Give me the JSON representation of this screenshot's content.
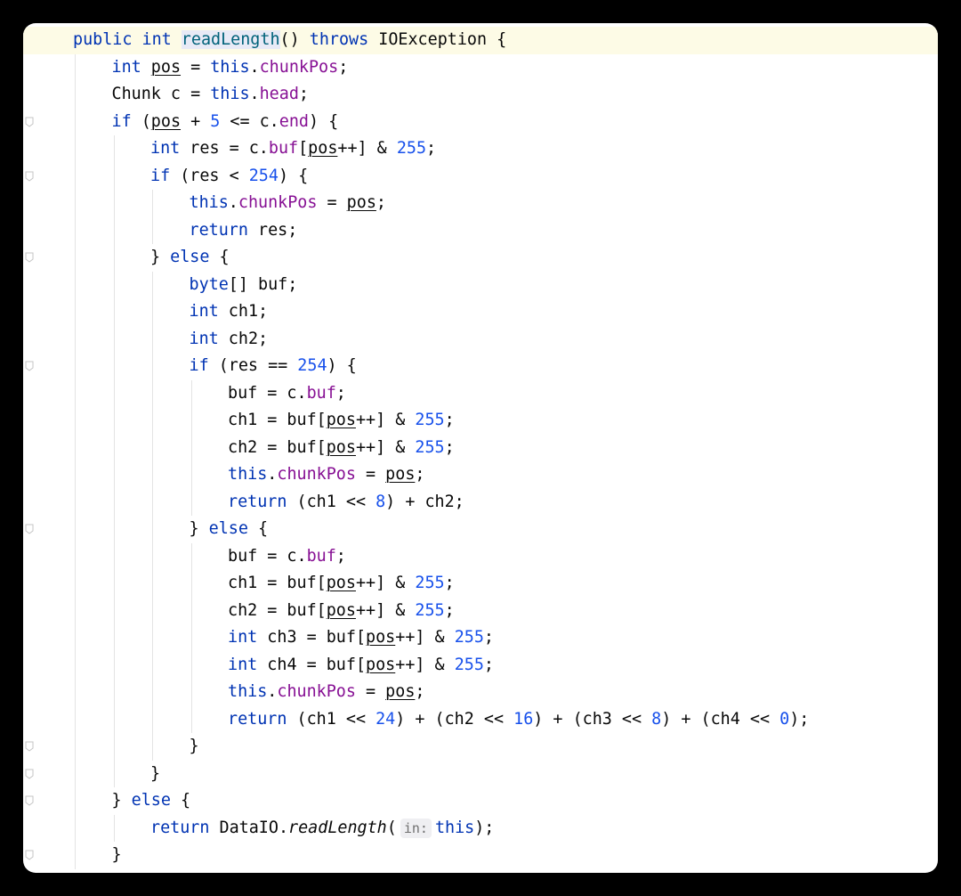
{
  "editor": {
    "language": "java",
    "intention_icon": "lightbulb-icon",
    "colors": {
      "keyword": "#0033b3",
      "field": "#871094",
      "number": "#1750eb",
      "method": "#00627a",
      "text": "#080808",
      "background": "#ffffff",
      "frame": "#000000"
    },
    "lines": [
      {
        "indent": 0,
        "current": true,
        "tokens": [
          {
            "t": "public int ",
            "c": "kw"
          },
          {
            "t": "readLength",
            "c": "mth hl"
          },
          {
            "t": "() "
          },
          {
            "t": "throws ",
            "c": "kw"
          },
          {
            "t": "IOException {"
          }
        ]
      },
      {
        "indent": 1,
        "tokens": [
          {
            "t": "int ",
            "c": "kw"
          },
          {
            "t": "pos",
            "c": "var"
          },
          {
            "t": " = "
          },
          {
            "t": "this",
            "c": "kw"
          },
          {
            "t": "."
          },
          {
            "t": "chunkPos",
            "c": "fld"
          },
          {
            "t": ";"
          }
        ]
      },
      {
        "indent": 1,
        "tokens": [
          {
            "t": "Chunk c = "
          },
          {
            "t": "this",
            "c": "kw"
          },
          {
            "t": "."
          },
          {
            "t": "head",
            "c": "fld"
          },
          {
            "t": ";"
          }
        ]
      },
      {
        "indent": 1,
        "tokens": [
          {
            "t": "if ",
            "c": "kw"
          },
          {
            "t": "("
          },
          {
            "t": "pos",
            "c": "var"
          },
          {
            "t": " + "
          },
          {
            "t": "5",
            "c": "num"
          },
          {
            "t": " <= c."
          },
          {
            "t": "end",
            "c": "fld"
          },
          {
            "t": ") {"
          }
        ]
      },
      {
        "indent": 2,
        "tokens": [
          {
            "t": "int ",
            "c": "kw"
          },
          {
            "t": "res = c."
          },
          {
            "t": "buf",
            "c": "fld"
          },
          {
            "t": "["
          },
          {
            "t": "pos",
            "c": "var"
          },
          {
            "t": "++] & "
          },
          {
            "t": "255",
            "c": "num"
          },
          {
            "t": ";"
          }
        ]
      },
      {
        "indent": 2,
        "tokens": [
          {
            "t": "if ",
            "c": "kw"
          },
          {
            "t": "(res < "
          },
          {
            "t": "254",
            "c": "num"
          },
          {
            "t": ") {"
          }
        ]
      },
      {
        "indent": 3,
        "tokens": [
          {
            "t": "this",
            "c": "kw"
          },
          {
            "t": "."
          },
          {
            "t": "chunkPos",
            "c": "fld"
          },
          {
            "t": " = "
          },
          {
            "t": "pos",
            "c": "var"
          },
          {
            "t": ";"
          }
        ]
      },
      {
        "indent": 3,
        "tokens": [
          {
            "t": "return ",
            "c": "kw"
          },
          {
            "t": "res;"
          }
        ]
      },
      {
        "indent": 2,
        "tokens": [
          {
            "t": "} "
          },
          {
            "t": "else ",
            "c": "kw"
          },
          {
            "t": "{"
          }
        ]
      },
      {
        "indent": 3,
        "tokens": [
          {
            "t": "byte",
            "c": "kw"
          },
          {
            "t": "[] buf;"
          }
        ]
      },
      {
        "indent": 3,
        "tokens": [
          {
            "t": "int ",
            "c": "kw"
          },
          {
            "t": "ch1;"
          }
        ]
      },
      {
        "indent": 3,
        "tokens": [
          {
            "t": "int ",
            "c": "kw"
          },
          {
            "t": "ch2;"
          }
        ]
      },
      {
        "indent": 3,
        "tokens": [
          {
            "t": "if ",
            "c": "kw"
          },
          {
            "t": "(res == "
          },
          {
            "t": "254",
            "c": "num"
          },
          {
            "t": ") {"
          }
        ]
      },
      {
        "indent": 4,
        "tokens": [
          {
            "t": "buf = c."
          },
          {
            "t": "buf",
            "c": "fld"
          },
          {
            "t": ";"
          }
        ]
      },
      {
        "indent": 4,
        "tokens": [
          {
            "t": "ch1 = buf["
          },
          {
            "t": "pos",
            "c": "var"
          },
          {
            "t": "++] & "
          },
          {
            "t": "255",
            "c": "num"
          },
          {
            "t": ";"
          }
        ]
      },
      {
        "indent": 4,
        "tokens": [
          {
            "t": "ch2 = buf["
          },
          {
            "t": "pos",
            "c": "var"
          },
          {
            "t": "++] & "
          },
          {
            "t": "255",
            "c": "num"
          },
          {
            "t": ";"
          }
        ]
      },
      {
        "indent": 4,
        "tokens": [
          {
            "t": "this",
            "c": "kw"
          },
          {
            "t": "."
          },
          {
            "t": "chunkPos",
            "c": "fld"
          },
          {
            "t": " = "
          },
          {
            "t": "pos",
            "c": "var"
          },
          {
            "t": ";"
          }
        ]
      },
      {
        "indent": 4,
        "tokens": [
          {
            "t": "return ",
            "c": "kw"
          },
          {
            "t": "(ch1 << "
          },
          {
            "t": "8",
            "c": "num"
          },
          {
            "t": ") + ch2;"
          }
        ]
      },
      {
        "indent": 3,
        "tokens": [
          {
            "t": "} "
          },
          {
            "t": "else ",
            "c": "kw"
          },
          {
            "t": "{"
          }
        ]
      },
      {
        "indent": 4,
        "tokens": [
          {
            "t": "buf = c."
          },
          {
            "t": "buf",
            "c": "fld"
          },
          {
            "t": ";"
          }
        ]
      },
      {
        "indent": 4,
        "tokens": [
          {
            "t": "ch1 = buf["
          },
          {
            "t": "pos",
            "c": "var"
          },
          {
            "t": "++] & "
          },
          {
            "t": "255",
            "c": "num"
          },
          {
            "t": ";"
          }
        ]
      },
      {
        "indent": 4,
        "tokens": [
          {
            "t": "ch2 = buf["
          },
          {
            "t": "pos",
            "c": "var"
          },
          {
            "t": "++] & "
          },
          {
            "t": "255",
            "c": "num"
          },
          {
            "t": ";"
          }
        ]
      },
      {
        "indent": 4,
        "tokens": [
          {
            "t": "int ",
            "c": "kw"
          },
          {
            "t": "ch3 = buf["
          },
          {
            "t": "pos",
            "c": "var"
          },
          {
            "t": "++] & "
          },
          {
            "t": "255",
            "c": "num"
          },
          {
            "t": ";"
          }
        ]
      },
      {
        "indent": 4,
        "tokens": [
          {
            "t": "int ",
            "c": "kw"
          },
          {
            "t": "ch4 = buf["
          },
          {
            "t": "pos",
            "c": "var"
          },
          {
            "t": "++] & "
          },
          {
            "t": "255",
            "c": "num"
          },
          {
            "t": ";"
          }
        ]
      },
      {
        "indent": 4,
        "tokens": [
          {
            "t": "this",
            "c": "kw"
          },
          {
            "t": "."
          },
          {
            "t": "chunkPos",
            "c": "fld"
          },
          {
            "t": " = "
          },
          {
            "t": "pos",
            "c": "var"
          },
          {
            "t": ";"
          }
        ]
      },
      {
        "indent": 4,
        "tokens": [
          {
            "t": "return ",
            "c": "kw"
          },
          {
            "t": "(ch1 << "
          },
          {
            "t": "24",
            "c": "num"
          },
          {
            "t": ") + (ch2 << "
          },
          {
            "t": "16",
            "c": "num"
          },
          {
            "t": ") + (ch3 << "
          },
          {
            "t": "8",
            "c": "num"
          },
          {
            "t": ") + (ch4 << "
          },
          {
            "t": "0",
            "c": "num"
          },
          {
            "t": ");"
          }
        ]
      },
      {
        "indent": 3,
        "tokens": [
          {
            "t": "}"
          }
        ]
      },
      {
        "indent": 2,
        "tokens": [
          {
            "t": "}"
          }
        ]
      },
      {
        "indent": 1,
        "tokens": [
          {
            "t": "} "
          },
          {
            "t": "else ",
            "c": "kw"
          },
          {
            "t": "{"
          }
        ]
      },
      {
        "indent": 2,
        "tokens": [
          {
            "t": "return ",
            "c": "kw"
          },
          {
            "t": "DataIO."
          },
          {
            "t": "readLength",
            "c": "it"
          },
          {
            "t": "("
          },
          {
            "t": "in:",
            "c": "hint"
          },
          {
            "t": "this",
            "c": "kw"
          },
          {
            "t": ");"
          }
        ]
      },
      {
        "indent": 1,
        "tokens": [
          {
            "t": "}"
          }
        ]
      }
    ]
  }
}
